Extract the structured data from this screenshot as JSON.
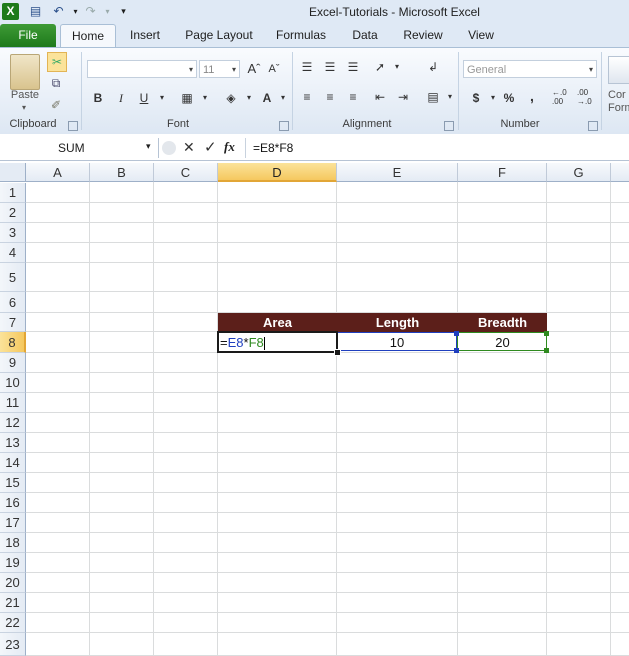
{
  "window": {
    "title": "Excel-Tutorials  -  Microsoft Excel"
  },
  "quick_access": {
    "icons": [
      "excel-logo-icon",
      "save-icon",
      "undo-icon",
      "redo-icon",
      "customize-toolbar-icon"
    ]
  },
  "ribbon_tabs": [
    "File",
    "Home",
    "Insert",
    "Page Layout",
    "Formulas",
    "Data",
    "Review",
    "View"
  ],
  "ribbon": {
    "clipboard": {
      "label": "Clipboard",
      "paste_label": "Paste"
    },
    "font": {
      "label": "Font",
      "font_name": "",
      "font_size": "11",
      "bold": "B",
      "italic": "I",
      "underline": "U",
      "font_color": "A"
    },
    "alignment": {
      "label": "Alignment"
    },
    "number": {
      "label": "Number",
      "format": "General",
      "currency": "$",
      "percent": "%",
      "comma": ",",
      "inc_decimal": "←.0\n.00",
      "dec_decimal": ".00\n→.0"
    },
    "cond_format_partial": "Cor\nForm"
  },
  "formula_bar": {
    "name_box": "SUM",
    "fx": "fx",
    "formula": "=E8*F8"
  },
  "grid": {
    "columns": [
      "A",
      "B",
      "C",
      "D",
      "E",
      "F",
      "G"
    ],
    "rows": [
      "1",
      "2",
      "3",
      "4",
      "5",
      "6",
      "7",
      "8",
      "9",
      "10",
      "11",
      "12",
      "13",
      "14",
      "15",
      "16",
      "17",
      "18",
      "19",
      "20",
      "21",
      "22",
      "23"
    ],
    "table": {
      "headers": [
        "Area",
        "Length",
        "Breadth"
      ],
      "row8": {
        "d_ref1": "E8",
        "d_op": "*",
        "d_ref2": "F8",
        "d_eq": "=",
        "e": "10",
        "f": "20"
      }
    }
  },
  "colors": {
    "accent_green": "#1e7a1b",
    "table_header_bg": "#5c1f1a",
    "selection_header": "#f5c85f",
    "ref_blue": "#1f3fbf",
    "ref_green": "#2f8a1f"
  }
}
